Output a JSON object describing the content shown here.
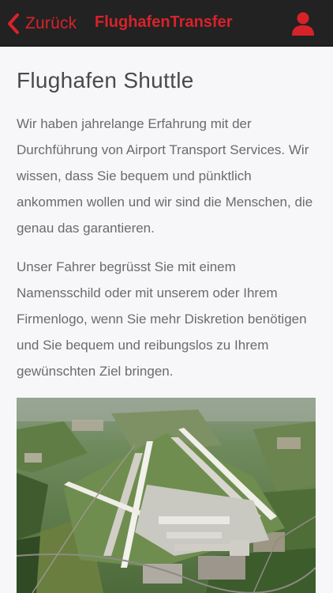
{
  "colors": {
    "accent": "#d8222a",
    "header_bg": "#222222",
    "page_bg": "#f7f7f9"
  },
  "header": {
    "back_icon": "chevron-left-icon",
    "back_label": "Zurück",
    "title": "FlughafenTransfer",
    "user_icon": "user-icon"
  },
  "main": {
    "title": "Flughafen Shuttle",
    "paragraphs": [
      "Wir haben jahrelange Erfahrung mit der Durchführung von Airport Transport Services. Wir wissen, dass Sie bequem und pünktlich ankommen wollen und wir sind die Menschen, die genau das garantieren.",
      "Unser Fahrer begrüsst Sie mit einem Namensschild oder mit unserem oder Ihrem Firmenlogo, wenn Sie mehr Diskretion benötigen und Sie bequem und reibungslos zu Ihrem gewünschten Ziel bringen."
    ]
  }
}
